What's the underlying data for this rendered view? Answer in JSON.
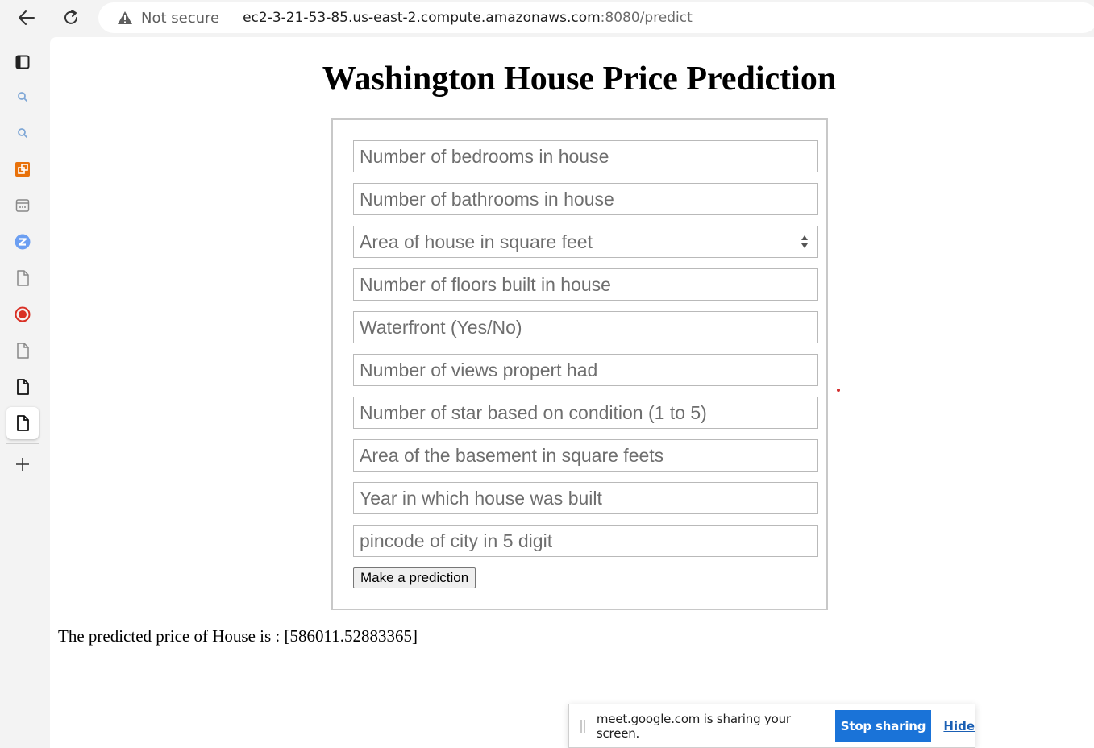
{
  "browser": {
    "back_icon": "back-arrow-icon",
    "reload_icon": "reload-icon",
    "security_icon": "warning-triangle-icon",
    "not_secure_label": "Not secure",
    "url_host": "ec2-3-21-53-85.us-east-2.compute.amazonaws.com",
    "url_rest": ":8080/predict"
  },
  "sidebar": {
    "items": [
      {
        "icon": "tab-panel-icon"
      },
      {
        "icon": "search-icon"
      },
      {
        "icon": "search-icon"
      },
      {
        "icon": "orange-extension-icon"
      },
      {
        "icon": "calendar-icon"
      },
      {
        "icon": "zoom-icon"
      },
      {
        "icon": "document-icon"
      },
      {
        "icon": "record-icon"
      },
      {
        "icon": "document-icon"
      },
      {
        "icon": "document-icon"
      },
      {
        "icon": "document-icon"
      },
      {
        "icon": "plus-icon"
      }
    ],
    "active_index": 10
  },
  "page": {
    "title": "Washington House Price Prediction",
    "fields": [
      {
        "placeholder": "Number of bedrooms in house"
      },
      {
        "placeholder": "Number of bathrooms in house"
      },
      {
        "placeholder": "Area of house in square feet",
        "number_spinner": true
      },
      {
        "placeholder": "Number of floors built in house"
      },
      {
        "placeholder": "Waterfront (Yes/No)"
      },
      {
        "placeholder": "Number of views propert had"
      },
      {
        "placeholder": "Number of star based on condition (1 to 5)"
      },
      {
        "placeholder": "Area of the basement in square feets"
      },
      {
        "placeholder": "Year in which house was built"
      },
      {
        "placeholder": "pincode of city in 5 digit"
      }
    ],
    "submit_label": "Make a prediction",
    "result_text": "The predicted price of House is : [586011.52883365]"
  },
  "share_bar": {
    "message": "meet.google.com is sharing your screen.",
    "stop_label": "Stop sharing",
    "hide_label": "Hide",
    "accent_color": "#1a73d8"
  }
}
